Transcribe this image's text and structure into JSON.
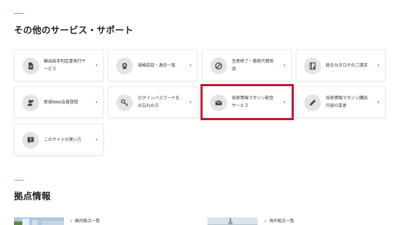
{
  "other_services": {
    "title": "その他のサービス・サポート",
    "cards": [
      {
        "label": "輸出該非判定書発行サ\nービス",
        "icon": "document-icon"
      },
      {
        "label": "規格認証・適合一覧",
        "icon": "certificate-badge-icon"
      },
      {
        "label": "生産終了・推奨代替商\n品",
        "icon": "prohibited-icon"
      },
      {
        "label": "総合カタログのご請求",
        "icon": "catalog-book-icon"
      },
      {
        "label": "新規Web会員登録",
        "icon": "user-register-icon"
      },
      {
        "label": "ログインパスワードを\nお忘れの方",
        "icon": "key-icon"
      },
      {
        "label": "技術情報マガジン配信\nサービス",
        "icon": "mail-icon"
      },
      {
        "label": "技術情報マガジン購読\n内容の変更",
        "icon": "pencil-icon"
      },
      {
        "label": "このサイトの使い方",
        "icon": "help-question-icon"
      }
    ],
    "chevron": "›"
  },
  "offices": {
    "title": "拠点情報",
    "domestic_label": "国内拠点一覧",
    "overseas_label": "海外拠点一覧",
    "chevron": "›"
  },
  "colors": {
    "accent": "#d0021b",
    "highlight": "#c8102e",
    "icon_bg": "#e4e4e4"
  }
}
